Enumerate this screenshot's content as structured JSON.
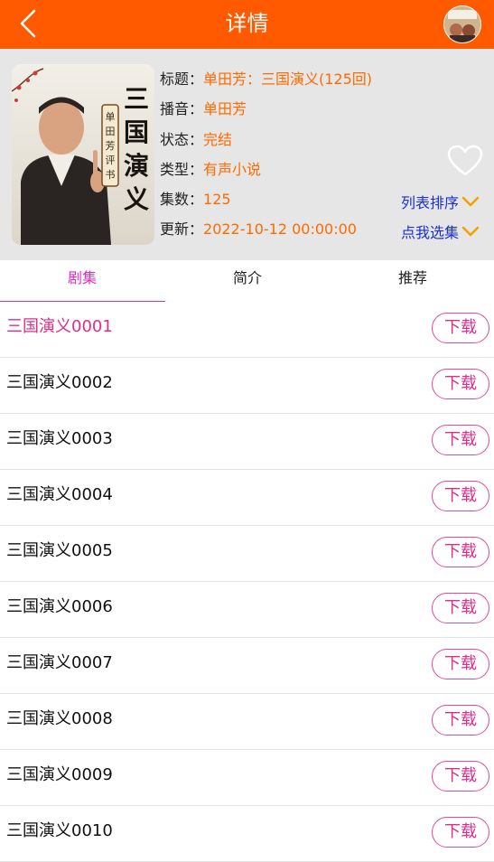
{
  "header": {
    "title": "详情"
  },
  "info": {
    "cover_text": {
      "main_title": "三国演义",
      "series_label": "单田芳评书"
    },
    "fields": [
      {
        "label": "标题：",
        "value": "单田芳：三国演义(125回)"
      },
      {
        "label": "播音：",
        "value": "单田芳"
      },
      {
        "label": "状态：",
        "value": "完结"
      },
      {
        "label": "类型：",
        "value": "有声小说"
      },
      {
        "label": "集数：",
        "value": "125"
      },
      {
        "label": "更新：",
        "value": "2022-10-12 00:00:00"
      }
    ],
    "sort_label": "列表排序",
    "select_label": "点我选集"
  },
  "tabs": [
    {
      "label": "剧集"
    },
    {
      "label": "简介"
    },
    {
      "label": "推荐"
    }
  ],
  "episodes": [
    {
      "title": "三国演义0001",
      "download_label": "下载"
    },
    {
      "title": "三国演义0002",
      "download_label": "下载"
    },
    {
      "title": "三国演义0003",
      "download_label": "下载"
    },
    {
      "title": "三国演义0004",
      "download_label": "下载"
    },
    {
      "title": "三国演义0005",
      "download_label": "下载"
    },
    {
      "title": "三国演义0006",
      "download_label": "下载"
    },
    {
      "title": "三国演义0007",
      "download_label": "下载"
    },
    {
      "title": "三国演义0008",
      "download_label": "下载"
    },
    {
      "title": "三国演义0009",
      "download_label": "下载"
    },
    {
      "title": "三国演义0010",
      "download_label": "下载"
    }
  ],
  "colors": {
    "header_bg": "#ff5a00",
    "value_text": "#ff6a00",
    "accent": "#e02dc0",
    "link": "#1a2fd6",
    "chevron": "#f5a000"
  }
}
